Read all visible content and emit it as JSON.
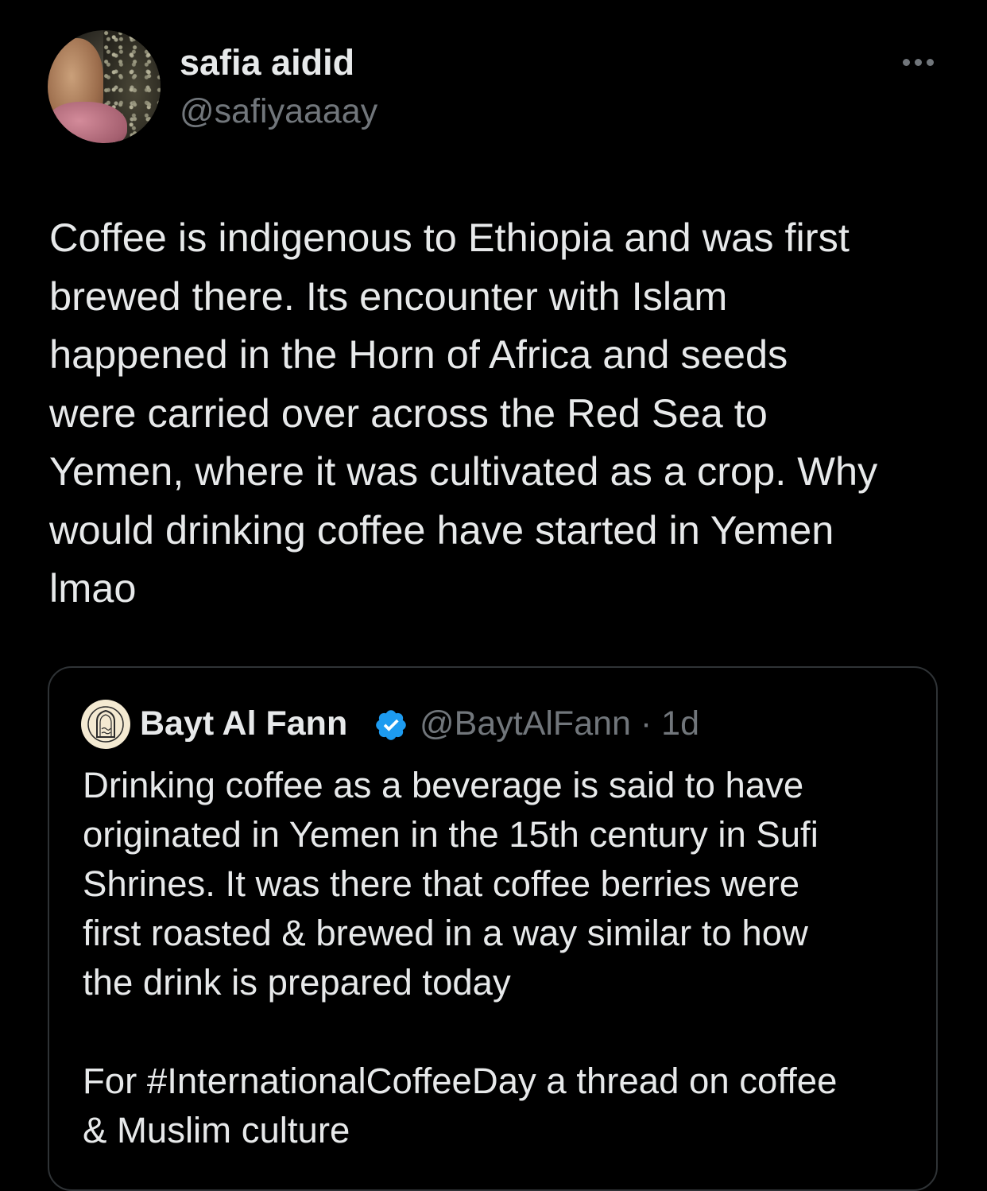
{
  "tweet": {
    "author_name": "safia aidid",
    "author_handle": "@safiyaaaay",
    "more_icon": "more-horizontal-icon",
    "text_lines": [
      "Coffee is indigenous to Ethiopia and was first",
      "brewed there. Its encounter with Islam",
      "happened in the Horn of Africa and seeds",
      "were carried over across the Red Sea to",
      "Yemen, where it was cultivated as a crop. Why",
      "would drinking coffee have started in Yemen",
      "lmao"
    ]
  },
  "quoted_tweet": {
    "author_name": "Bayt Al Fann",
    "verified_icon": "verified-badge-icon",
    "handle_and_time": "@BaytAlFann · 1d",
    "text_lines": [
      "Drinking coffee as a beverage is said to have",
      "originated in Yemen in the 15th century in Sufi",
      "Shrines. It was there that coffee berries were",
      "first roasted & brewed in a way similar to how",
      "the drink is prepared today",
      "",
      "For #InternationalCoffeeDay a thread on coffee",
      "& Muslim culture"
    ]
  },
  "colors": {
    "background": "#000000",
    "primary_text": "#e7e9ea",
    "secondary_text": "#71767b",
    "border": "#2f3336",
    "verified_blue": "#1d9bf0"
  }
}
